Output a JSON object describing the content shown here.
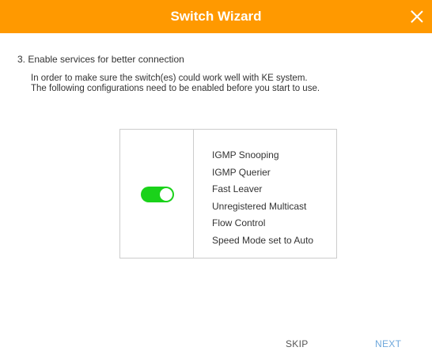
{
  "dialog": {
    "title": "Switch Wizard",
    "close_icon": "close-icon",
    "accent_color": "#ff9900"
  },
  "content": {
    "step": "3. Enable services for better connection",
    "description_line1": "In order to make sure the switch(es) could work well with KE system.",
    "description_line2": "The following configurations need to be enabled before you start to use."
  },
  "services": {
    "toggle_enabled": true,
    "toggle_color": "#1ad21a",
    "items": [
      "IGMP Snooping",
      "IGMP Querier",
      "Fast Leaver",
      "Unregistered Multicast",
      "Flow Control",
      "Speed Mode set to Auto"
    ]
  },
  "footer": {
    "skip_label": "SKIP",
    "next_label": "NEXT"
  }
}
